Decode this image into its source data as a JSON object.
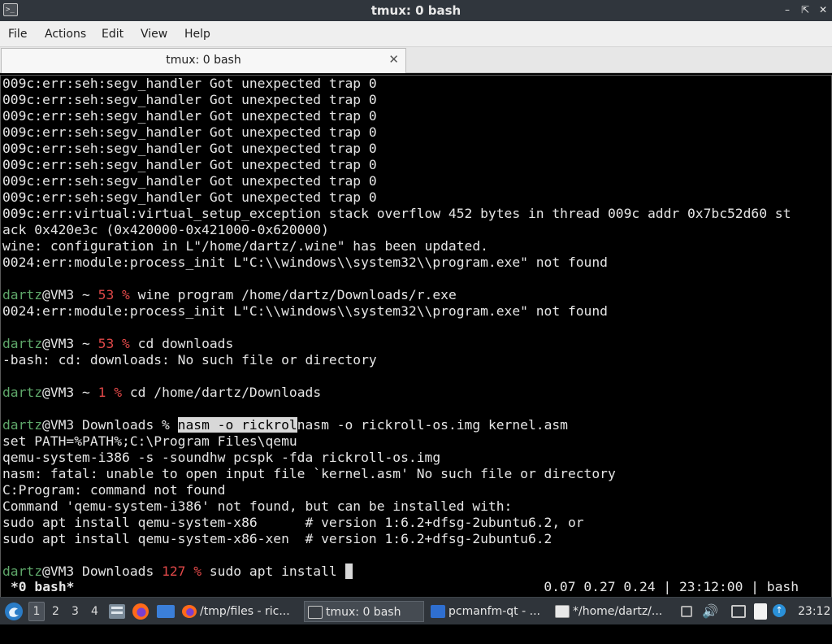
{
  "window": {
    "title": "tmux: 0 bash",
    "controls": {
      "minimize": "–",
      "restore": "⇱",
      "maximize": "⤢",
      "close": "✕"
    }
  },
  "menubar": [
    "File",
    "Actions",
    "Edit",
    "View",
    "Help"
  ],
  "tab": {
    "label": "tmux: 0 bash",
    "close": "✕"
  },
  "terminal": {
    "lines": [
      [
        {
          "t": "009c:err:seh:segv_handler Got unexpected trap 0"
        }
      ],
      [
        {
          "t": "009c:err:seh:segv_handler Got unexpected trap 0"
        }
      ],
      [
        {
          "t": "009c:err:seh:segv_handler Got unexpected trap 0"
        }
      ],
      [
        {
          "t": "009c:err:seh:segv_handler Got unexpected trap 0"
        }
      ],
      [
        {
          "t": "009c:err:seh:segv_handler Got unexpected trap 0"
        }
      ],
      [
        {
          "t": "009c:err:seh:segv_handler Got unexpected trap 0"
        }
      ],
      [
        {
          "t": "009c:err:seh:segv_handler Got unexpected trap 0"
        }
      ],
      [
        {
          "t": "009c:err:seh:segv_handler Got unexpected trap 0"
        }
      ],
      [
        {
          "t": "009c:err:virtual:virtual_setup_exception stack overflow 452 bytes in thread 009c addr 0x7bc52d60 st"
        }
      ],
      [
        {
          "t": "ack 0x420e3c (0x420000-0x421000-0x620000)"
        }
      ],
      [
        {
          "t": "wine: configuration in L\"/home/dartz/.wine\" has been updated."
        }
      ],
      [
        {
          "t": "0024:err:module:process_init L\"C:\\\\windows\\\\system32\\\\program.exe\" not found"
        }
      ],
      [
        {
          "t": ""
        }
      ],
      [
        {
          "t": "dartz",
          "c": "g"
        },
        {
          "t": "@VM3 ~ "
        },
        {
          "t": "53 %",
          "c": "r"
        },
        {
          "t": " wine program /home/dartz/Downloads/r.exe"
        }
      ],
      [
        {
          "t": "0024:err:module:process_init L\"C:\\\\windows\\\\system32\\\\program.exe\" not found"
        }
      ],
      [
        {
          "t": ""
        }
      ],
      [
        {
          "t": "dartz",
          "c": "g"
        },
        {
          "t": "@VM3 ~ "
        },
        {
          "t": "53 %",
          "c": "r"
        },
        {
          "t": " cd downloads"
        }
      ],
      [
        {
          "t": "-bash: cd: downloads: No such file or directory"
        }
      ],
      [
        {
          "t": ""
        }
      ],
      [
        {
          "t": "dartz",
          "c": "g"
        },
        {
          "t": "@VM3 ~ "
        },
        {
          "t": "1 %",
          "c": "r"
        },
        {
          "t": " cd /home/dartz/Downloads"
        }
      ],
      [
        {
          "t": ""
        }
      ],
      [
        {
          "t": "dartz",
          "c": "g"
        },
        {
          "t": "@VM3 Downloads % "
        },
        {
          "t": "nasm -o rickrol",
          "c": "sel"
        },
        {
          "t": "nasm -o rickroll-os.img kernel.asm"
        }
      ],
      [
        {
          "t": "set PATH=%PATH%;C:\\Program Files\\qemu"
        }
      ],
      [
        {
          "t": "qemu-system-i386 -s -soundhw pcspk -fda rickroll-os.img"
        }
      ],
      [
        {
          "t": "nasm: fatal: unable to open input file `kernel.asm' No such file or directory"
        }
      ],
      [
        {
          "t": "C:Program: command not found"
        }
      ],
      [
        {
          "t": "Command 'qemu-system-i386' not found, but can be installed with:"
        }
      ],
      [
        {
          "t": "sudo apt install qemu-system-x86      # version 1:6.2+dfsg-2ubuntu6.2, or"
        }
      ],
      [
        {
          "t": "sudo apt install qemu-system-x86-xen  # version 1:6.2+dfsg-2ubuntu6.2"
        }
      ],
      [
        {
          "t": ""
        }
      ],
      [
        {
          "t": "dartz",
          "c": "g"
        },
        {
          "t": "@VM3 Downloads "
        },
        {
          "t": "127 %",
          "c": "r"
        },
        {
          "t": " sudo apt install "
        },
        {
          "t": " ",
          "c": "cursor"
        }
      ]
    ],
    "status_left": "*0 bash*",
    "status_right": "0.07 0.27 0.24 | 23:12:00 | bash"
  },
  "taskbar": {
    "workspaces": [
      "1",
      "2",
      "3",
      "4"
    ],
    "active_workspace": "1",
    "tasks": [
      {
        "label": "/tmp/files - ric...",
        "icon": "firefox-icon"
      },
      {
        "label": "tmux: 0 bash",
        "icon": "terminal-icon"
      },
      {
        "label": "pcmanfm-qt - ...",
        "icon": "folder-icon"
      },
      {
        "label": "*/home/dartz/...",
        "icon": "text-editor-icon"
      }
    ],
    "clock": "23:12"
  },
  "colors": {
    "prompt_user": "#5fa86a",
    "prompt_status": "#e04848",
    "titlebar": "#30363d",
    "taskbar": "#2f343a"
  }
}
